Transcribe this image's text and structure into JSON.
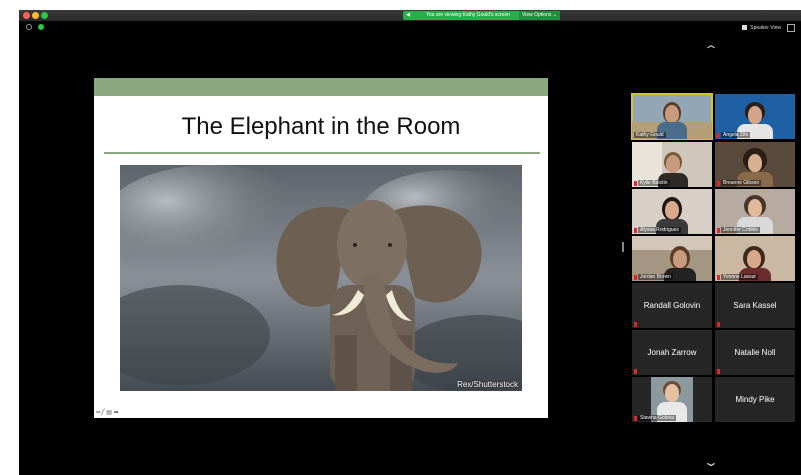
{
  "banner": {
    "sharing_text": "You are viewing Kathy Gould's screen",
    "view_options": "View Options ⌄"
  },
  "toolbar": {
    "speaker_view": "Speaker View"
  },
  "slide": {
    "title": "The Elephant in the Room",
    "credit": "Rex/Shutterstock",
    "tools": "✏╱ ▤ ➡"
  },
  "participants": [
    {
      "name": "Kathy Gould",
      "video": true,
      "muted": false,
      "active": true
    },
    {
      "name": "Angela Zito",
      "video": true,
      "muted": true
    },
    {
      "name": "Kylie Balotin",
      "video": true,
      "muted": true
    },
    {
      "name": "Breanne Gibson",
      "video": true,
      "muted": true
    },
    {
      "name": "Alyssa Rodriguez",
      "video": true,
      "muted": true
    },
    {
      "name": "Jennifer Cribble",
      "video": true,
      "muted": true
    },
    {
      "name": "Jordan Brown",
      "video": true,
      "muted": true
    },
    {
      "name": "Yvonne Lassur",
      "video": true,
      "muted": true
    },
    {
      "name": "Randall Golovin",
      "video": false,
      "muted": true
    },
    {
      "name": "Sara Kassel",
      "video": false,
      "muted": true
    },
    {
      "name": "Jonah Zarrow",
      "video": false,
      "muted": true
    },
    {
      "name": "Natalie Noll",
      "video": false,
      "muted": true
    },
    {
      "name": "Stavina Golova",
      "video": true,
      "muted": true
    },
    {
      "name": "Mindy Pike",
      "video": false,
      "muted": false
    }
  ],
  "colors": {
    "banner_green": "#27b04a",
    "slide_accent": "#8aa981",
    "active_speaker": "#d6c22b",
    "mute_red": "#e0262a"
  }
}
